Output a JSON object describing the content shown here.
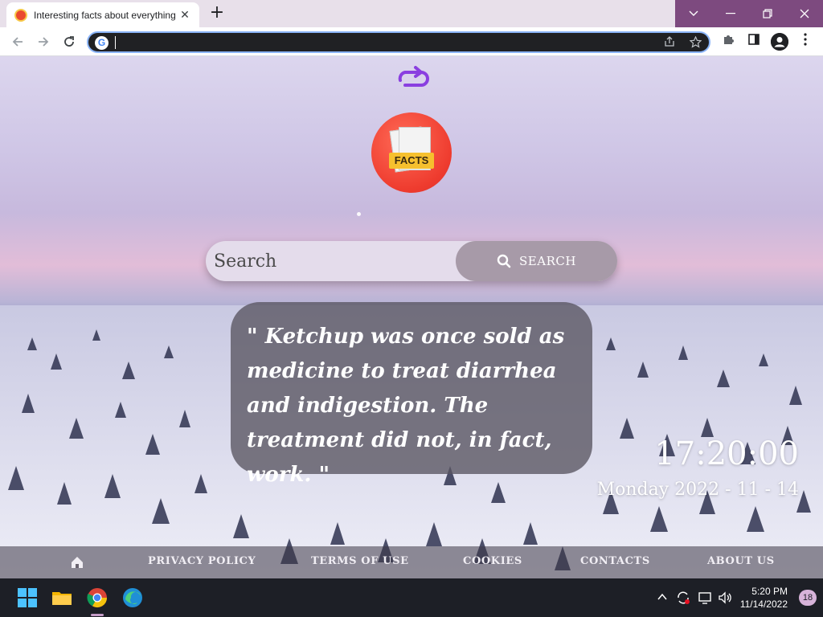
{
  "browser": {
    "tab": {
      "title": "Interesting facts about everything",
      "close_glyph": "✕"
    },
    "new_tab_glyph": "+",
    "window_controls": {
      "dropdown": "⌵",
      "minimize": "—",
      "restore": "❐",
      "close": "✕"
    },
    "address": {
      "value": "",
      "placeholder": ""
    }
  },
  "page": {
    "logo_text": "FACTS",
    "search": {
      "placeholder": "Search",
      "button_label": "SEARCH"
    },
    "fact": "\"  Ketchup was once sold as medicine to treat diarrhea and indigestion. The treatment did not, in fact, work.  \"",
    "clock": "17:20:00",
    "date": "Monday 2022 - 11 - 14",
    "footer": {
      "links": [
        "PRIVACY POLICY",
        "TERMS OF USE",
        "COOKIES",
        "CONTACTS",
        "ABOUT US"
      ]
    },
    "colors": {
      "accent": "#7d3fd6",
      "search_button": "#a79aa8",
      "fact_box": "#585460"
    }
  },
  "taskbar": {
    "time": "5:20 PM",
    "date": "11/14/2022",
    "notifications": "18",
    "icons": [
      "windows-start-icon",
      "file-explorer-icon",
      "chrome-icon",
      "edge-icon"
    ]
  }
}
